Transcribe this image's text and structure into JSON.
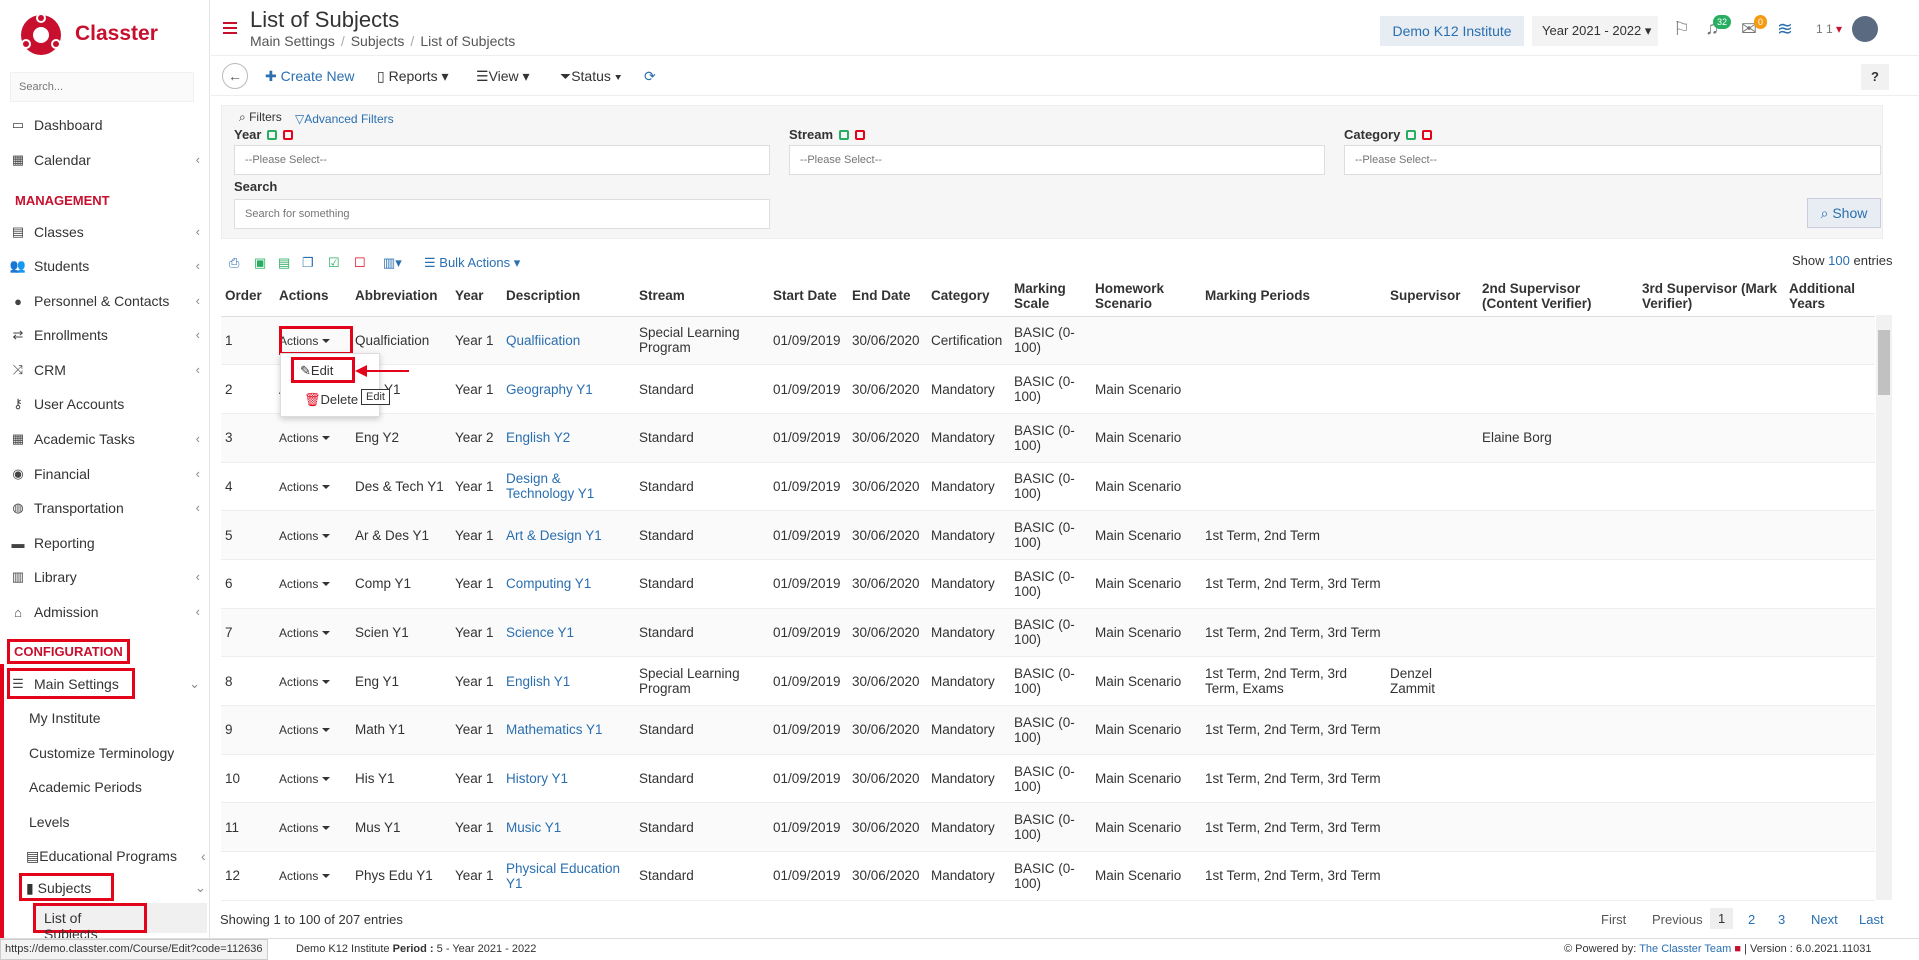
{
  "brand": {
    "name": "Classter",
    "color": "#c8102e"
  },
  "sidebar": {
    "search_placeholder": "Search...",
    "items": [
      {
        "label": "Dashboard",
        "icon": "monitor-icon"
      },
      {
        "label": "Calendar",
        "icon": "calendar-icon"
      },
      {
        "label": "Classes",
        "icon": "classes-icon"
      },
      {
        "label": "Students",
        "icon": "students-icon"
      },
      {
        "label": "Personnel & Contacts",
        "icon": "person-icon"
      },
      {
        "label": "Enrollments",
        "icon": "arrows-icon"
      },
      {
        "label": "CRM",
        "icon": "crm-icon"
      },
      {
        "label": "User Accounts",
        "icon": "key-icon"
      },
      {
        "label": "Academic Tasks",
        "icon": "grid-icon"
      },
      {
        "label": "Financial",
        "icon": "coins-icon"
      },
      {
        "label": "Transportation",
        "icon": "bus-icon"
      },
      {
        "label": "Reporting",
        "icon": "printer-icon"
      },
      {
        "label": "Library",
        "icon": "books-icon"
      },
      {
        "label": "Admission",
        "icon": "building-icon"
      }
    ],
    "section_management": "MANAGEMENT",
    "section_configuration": "CONFIGURATION",
    "main_settings": "Main Settings",
    "sub_items": [
      "My Institute",
      "Customize Terminology",
      "Academic Periods",
      "Levels",
      "Educational Programs"
    ],
    "subjects": "Subjects",
    "list_of_subjects": "List of Subjects"
  },
  "header": {
    "title": "List of Subjects",
    "breadcrumb": [
      "Main Settings",
      "Subjects",
      "List of Subjects"
    ],
    "institute": "Demo K12 Institute",
    "year": "Year 2021 - 2022",
    "notif_count": "32",
    "msg_count": "0",
    "user_short": "1 1"
  },
  "toolbar": {
    "create_new": "Create New",
    "reports": "Reports",
    "view": "View",
    "status": "Status",
    "help": "?"
  },
  "filters": {
    "filters_label": "Filters",
    "advanced": "Advanced Filters",
    "year_label": "Year",
    "stream_label": "Stream",
    "category_label": "Category",
    "search_label": "Search",
    "select_placeholder": "--Please Select--",
    "search_placeholder": "Search for something",
    "show_button": "Show"
  },
  "table_tools": {
    "bulk_actions": "Bulk Actions",
    "show_label": "Show",
    "show_count": "100",
    "entries_label": "entries"
  },
  "table": {
    "headers": [
      "Order",
      "Actions",
      "Abbreviation",
      "Year",
      "Description",
      "Stream",
      "Start Date",
      "End Date",
      "Category",
      "Marking Scale",
      "Homework Scenario",
      "Marking Periods",
      "Supervisor",
      "2nd Supervisor (Content Verifier)",
      "3rd Supervisor (Mark Verifier)",
      "Additional Years"
    ],
    "actions_label": "Actions",
    "rows": [
      [
        "1",
        "Qualficiation",
        "Year 1",
        "Qualfiication",
        "Special Learning Program",
        "01/09/2019",
        "30/06/2020",
        "Certification",
        "BASIC (0-100)",
        "",
        "",
        "",
        "",
        "",
        ""
      ],
      [
        "2",
        "Geo Y1",
        "Year 1",
        "Geography Y1",
        "Standard",
        "01/09/2019",
        "30/06/2020",
        "Mandatory",
        "BASIC (0-100)",
        "Main Scenario",
        "",
        "",
        "",
        "",
        ""
      ],
      [
        "3",
        "Eng Y2",
        "Year 2",
        "English Y2",
        "Standard",
        "01/09/2019",
        "30/06/2020",
        "Mandatory",
        "BASIC (0-100)",
        "Main Scenario",
        "",
        "",
        "Elaine Borg",
        "",
        ""
      ],
      [
        "4",
        "Des & Tech Y1",
        "Year 1",
        "Design & Technology Y1",
        "Standard",
        "01/09/2019",
        "30/06/2020",
        "Mandatory",
        "BASIC (0-100)",
        "Main Scenario",
        "",
        "",
        "",
        "",
        ""
      ],
      [
        "5",
        "Ar & Des Y1",
        "Year 1",
        "Art & Design Y1",
        "Standard",
        "01/09/2019",
        "30/06/2020",
        "Mandatory",
        "BASIC (0-100)",
        "Main Scenario",
        "1st Term, 2nd Term",
        "",
        "",
        "",
        ""
      ],
      [
        "6",
        "Comp Y1",
        "Year 1",
        "Computing Y1",
        "Standard",
        "01/09/2019",
        "30/06/2020",
        "Mandatory",
        "BASIC (0-100)",
        "Main Scenario",
        "1st Term, 2nd Term, 3rd Term",
        "",
        "",
        "",
        ""
      ],
      [
        "7",
        "Scien Y1",
        "Year 1",
        "Science Y1",
        "Standard",
        "01/09/2019",
        "30/06/2020",
        "Mandatory",
        "BASIC (0-100)",
        "Main Scenario",
        "1st Term, 2nd Term, 3rd Term",
        "",
        "",
        "",
        ""
      ],
      [
        "8",
        "Eng Y1",
        "Year 1",
        "English Y1",
        "Special Learning Program",
        "01/09/2019",
        "30/06/2020",
        "Mandatory",
        "BASIC (0-100)",
        "Main Scenario",
        "1st Term, 2nd Term, 3rd Term, Exams",
        "Denzel Zammit",
        "",
        "",
        ""
      ],
      [
        "9",
        "Math Y1",
        "Year 1",
        "Mathematics Y1",
        "Standard",
        "01/09/2019",
        "30/06/2020",
        "Mandatory",
        "BASIC (0-100)",
        "Main Scenario",
        "1st Term, 2nd Term, 3rd Term",
        "",
        "",
        "",
        ""
      ],
      [
        "10",
        "His Y1",
        "Year 1",
        "History Y1",
        "Standard",
        "01/09/2019",
        "30/06/2020",
        "Mandatory",
        "BASIC (0-100)",
        "Main Scenario",
        "1st Term, 2nd Term, 3rd Term",
        "",
        "",
        "",
        ""
      ],
      [
        "11",
        "Mus Y1",
        "Year 1",
        "Music Y1",
        "Standard",
        "01/09/2019",
        "30/06/2020",
        "Mandatory",
        "BASIC (0-100)",
        "Main Scenario",
        "1st Term, 2nd Term, 3rd Term",
        "",
        "",
        "",
        ""
      ],
      [
        "12",
        "Phys Edu Y1",
        "Year 1",
        "Physical Education Y1",
        "Standard",
        "01/09/2019",
        "30/06/2020",
        "Mandatory",
        "BASIC (0-100)",
        "Main Scenario",
        "1st Term, 2nd Term, 3rd Term",
        "",
        "",
        "",
        ""
      ]
    ]
  },
  "dropdown": {
    "edit": "Edit",
    "delete": "Delete",
    "tooltip": "Edit"
  },
  "footer": {
    "showing": "Showing 1 to 100 of 207 entries",
    "pagination": [
      "First",
      "Previous",
      "1",
      "2",
      "3",
      "Next",
      "Last"
    ]
  },
  "status_bar": {
    "url": "https://demo.classter.com/Course/Edit?code=112636",
    "institute": "Demo K12 Institute",
    "period_label": "Period :",
    "period": "5 - Year 2021 - 2022",
    "powered_by": "Powered by:",
    "team": "The Classter Team",
    "version": "Version : 6.0.2021.11031"
  }
}
